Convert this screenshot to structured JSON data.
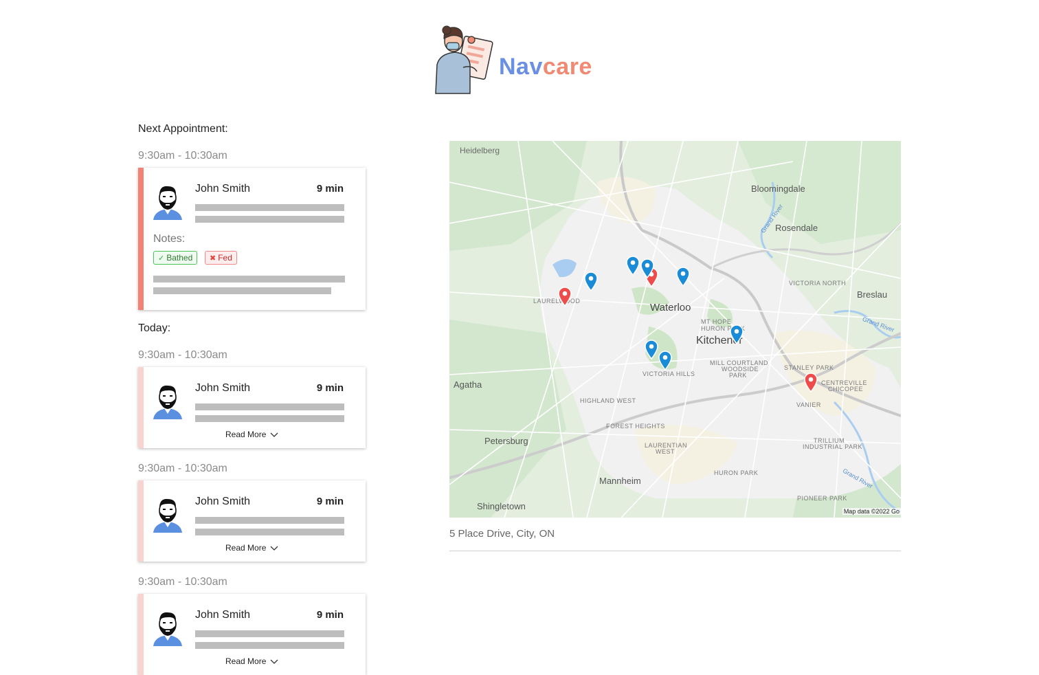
{
  "brand": {
    "name_part1": "Nav",
    "name_part2": "care"
  },
  "next_appointment": {
    "heading": "Next Appointment:",
    "time": "9:30am - 10:30am",
    "patient": "John Smith",
    "eta": "9 min",
    "notes_label": "Notes:",
    "tags": [
      {
        "label": "Bathed",
        "status": "done",
        "color": "#4cc35a"
      },
      {
        "label": "Fed",
        "status": "not-done",
        "color": "#ef8a84"
      }
    ]
  },
  "today": {
    "heading": "Today:",
    "appointments": [
      {
        "time": "9:30am - 10:30am",
        "patient": "John Smith",
        "eta": "9 min",
        "action": "Read More"
      },
      {
        "time": "9:30am - 10:30am",
        "patient": "John Smith",
        "eta": "9 min",
        "action": "Read More"
      },
      {
        "time": "9:30am - 10:30am",
        "patient": "John Smith",
        "eta": "9 min",
        "action": "Read More"
      }
    ]
  },
  "map": {
    "labels": {
      "heidelberg": "Heidelberg",
      "bloomingdale": "Bloomingdale",
      "rosendale": "Rosendale",
      "breslau": "Breslau",
      "victoria_north": "VICTORIA NORTH",
      "waterloo": "Waterloo",
      "kitchener": "Kitchener",
      "laurelwood": "LAURELWOOD",
      "mt_hope": "MT HOPE",
      "huron_park_n": "HURON PARK",
      "mill_courtland": "MILL COURTLAND",
      "woodside": "WOODSIDE",
      "park": "PARK",
      "victoria_hills": "VICTORIA HILLS",
      "stanley_park": "STANLEY PARK",
      "centreville": "CENTREVILLE",
      "chicopee": "CHICOPEE",
      "agatha": "Agatha",
      "highland_west": "HIGHLAND WEST",
      "vanier": "VANIER",
      "forest_heights": "FOREST HEIGHTS",
      "petersburg": "Petersburg",
      "laurentian_west_1": "LAURENTIAN",
      "laurentian_west_2": "WEST",
      "trillium_1": "TRILLIUM",
      "trillium_2": "INDUSTRIAL PARK",
      "mannheim": "Mannheim",
      "huron_park_s": "HURON PARK",
      "pioneer_park": "PIONEER PARK",
      "shingletown": "Shingletown",
      "grand_river": "Grand River"
    },
    "credit": "Map data ©2022 Go",
    "pin_colors": {
      "blue": "#1a8bd6",
      "red": "#ee4b4b"
    },
    "address": "5 Place Drive, City, ON"
  },
  "colors": {
    "accent": "#f28276",
    "accent_light": "#f7d4d0",
    "brand_blue": "#6a8fe3",
    "brand_coral": "#f08a73"
  }
}
